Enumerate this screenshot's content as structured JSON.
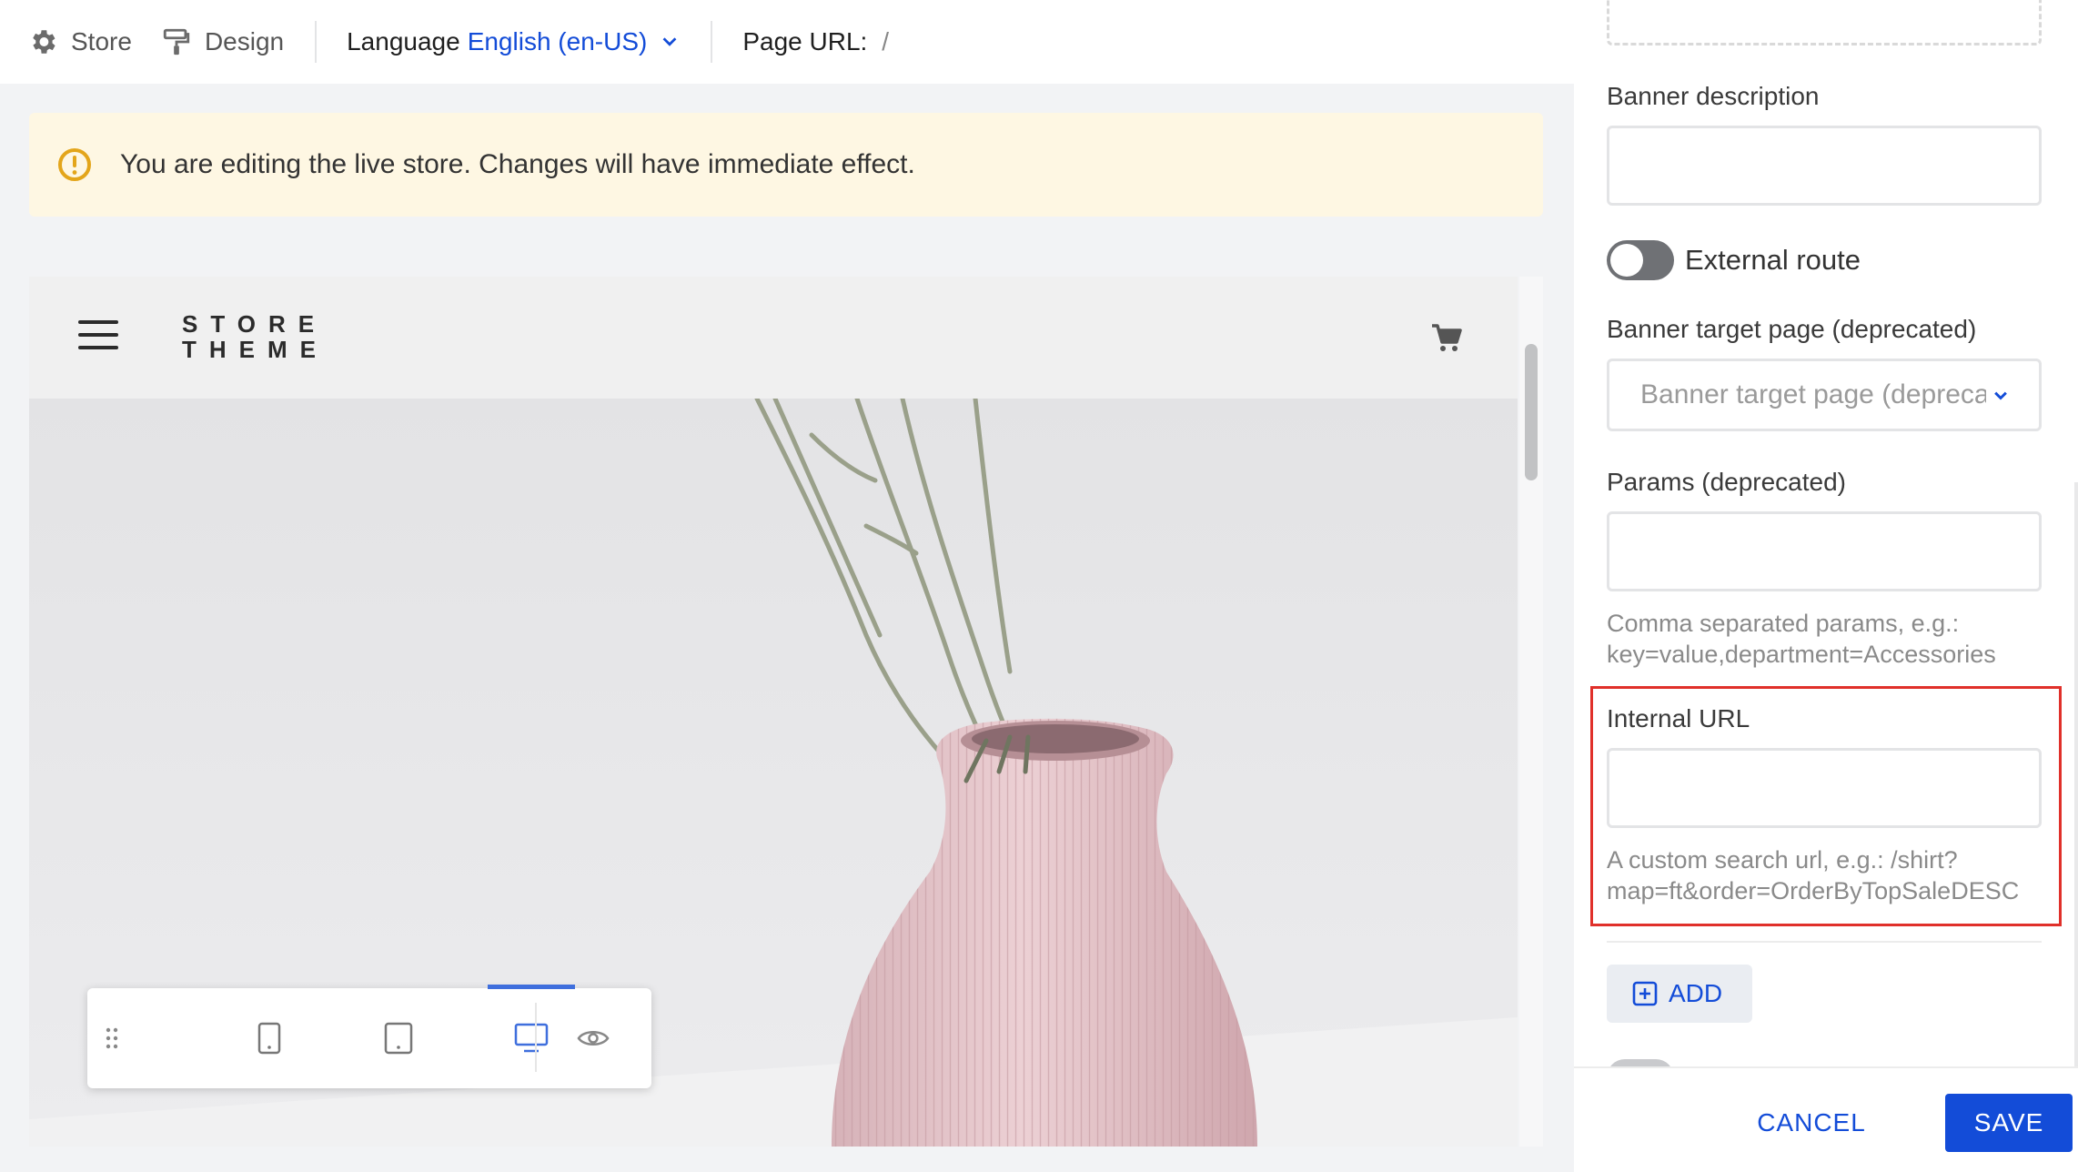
{
  "topbar": {
    "store_label": "Store",
    "design_label": "Design",
    "language_label": "Language",
    "language_value": "English (en-US)",
    "page_url_label": "Page URL:",
    "page_url_value": "/"
  },
  "warning": {
    "text": "You are editing the live store. Changes will have immediate effect."
  },
  "storefront": {
    "logo_line1": "STORE",
    "logo_line2": "THEME"
  },
  "device_toolbar": {
    "active_device": "desktop"
  },
  "panel": {
    "banner_description_label": "Banner description",
    "banner_description_value": "",
    "external_route_label": "External route",
    "external_route_on": false,
    "banner_target_label": "Banner target page (deprecated)",
    "banner_target_placeholder": "Banner target page (deprecated)",
    "params_label": "Params (deprecated)",
    "params_value": "",
    "params_help_line1": "Comma separated params, e.g.:",
    "params_help_line2": "key=value,department=Accessories",
    "internal_url_label": "Internal URL",
    "internal_url_value": "",
    "internal_url_help_line1": "A custom search url, e.g.: /shirt?",
    "internal_url_help_line2": "map=ft&order=OrderByTopSaleDESC",
    "add_label": "ADD",
    "cancel_label": "CANCEL",
    "save_label": "SAVE"
  },
  "colors": {
    "accent": "#134cd8",
    "warning_bg": "#fef7e3",
    "warning_icon": "#e3a51a",
    "highlight": "#e0302a"
  }
}
